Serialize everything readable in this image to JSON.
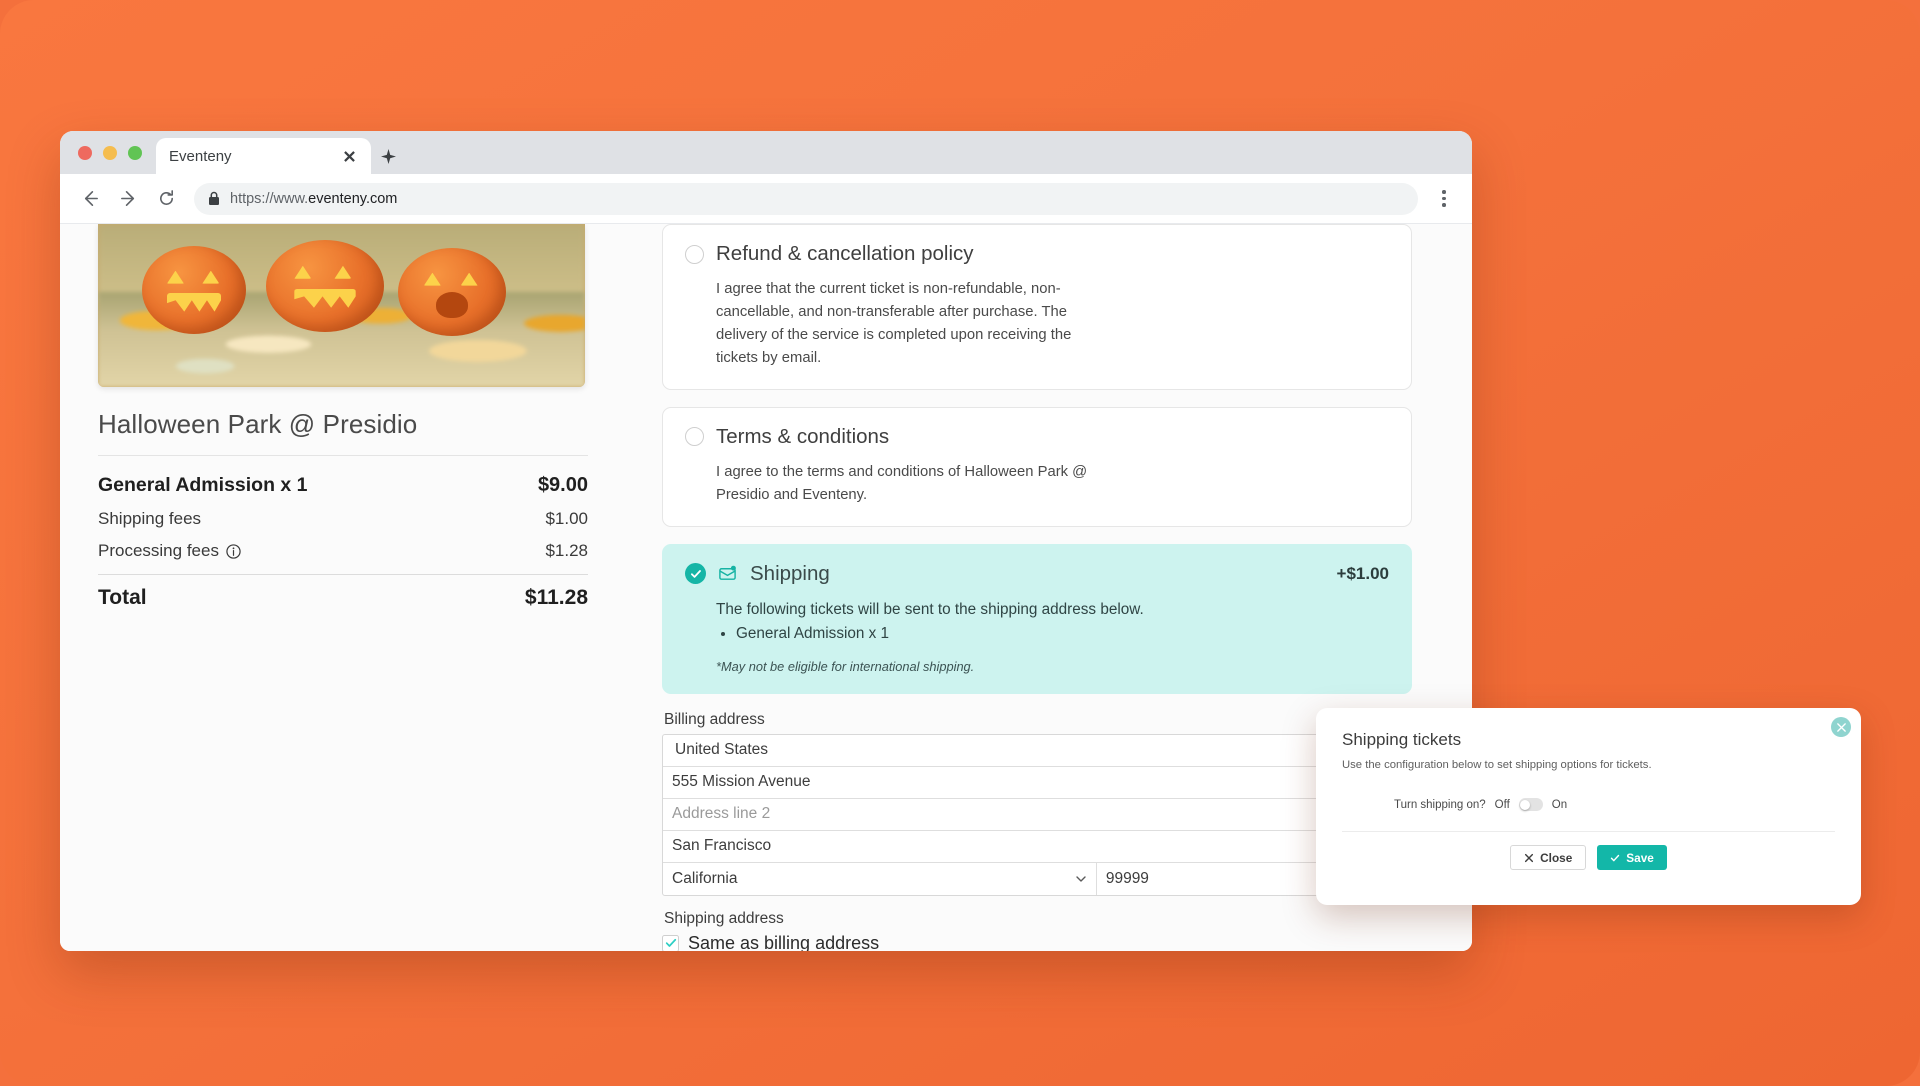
{
  "browser": {
    "tab_title": "Eventeny",
    "url_prefix": "https://www.",
    "url_domain": "eventeny.com",
    "url_full": "https://www.eventeny.com"
  },
  "order_summary": {
    "event_title": "Halloween Park @ Presidio",
    "items": [
      {
        "label": "General Admission x 1",
        "value": "$9.00",
        "type": "item"
      },
      {
        "label": "Shipping fees",
        "value": "$1.00",
        "type": "fee"
      },
      {
        "label": "Processing fees",
        "value": "$1.28",
        "type": "fee",
        "icon": "info-icon"
      }
    ],
    "total_label": "Total",
    "total_value": "$11.28"
  },
  "agreements": [
    {
      "title": "Refund & cancellation policy",
      "body": "I agree that the current ticket is non-refundable, non-cancellable, and non-transferable after purchase. The delivery of the service is completed upon receiving the tickets by email.",
      "selected": false
    },
    {
      "title": "Terms & conditions",
      "body": "I agree to the terms and conditions of Halloween Park @ Presidio and Eventeny.",
      "selected": false
    }
  ],
  "shipping_option": {
    "title": "Shipping",
    "price": "+$1.00",
    "body": "The following tickets will be sent to the shipping address below.",
    "tickets": [
      "General Admission x 1"
    ],
    "note": "*May not be eligible for international shipping.",
    "selected": true,
    "accent_color": "#15b5a6",
    "background_color": "#cdf3ef"
  },
  "billing": {
    "label": "Billing address",
    "country": "United States",
    "address1": "555 Mission Avenue",
    "address2_placeholder": "Address line 2",
    "city": "San Francisco",
    "state": "California",
    "zip": "99999"
  },
  "shipping_address": {
    "label": "Shipping address",
    "same_as_billing_label": "Same as billing address",
    "same_as_billing_checked": true
  },
  "popover": {
    "title": "Shipping tickets",
    "subtitle": "Use the configuration below to set shipping options for tickets.",
    "toggle_question": "Turn shipping on?",
    "toggle_off_label": "Off",
    "toggle_on_label": "On",
    "toggle_state": "off",
    "close_label": "Close",
    "save_label": "Save",
    "accent_color": "#13b7a8"
  }
}
